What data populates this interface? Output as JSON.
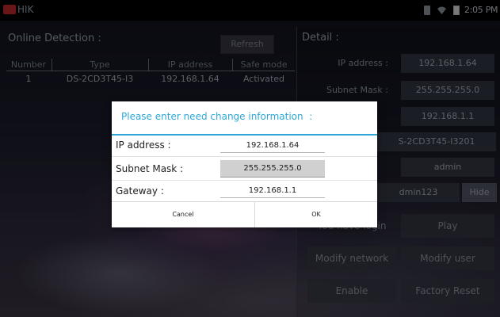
{
  "statusbar": {
    "app_title": "HIK",
    "time": "2:05 PM",
    "icons": [
      "app-logo-icon",
      "sim-card-icon",
      "wifi-icon",
      "battery-icon"
    ]
  },
  "online_detection": {
    "title": "Online Detection :",
    "refresh_label": "Refresh",
    "columns": [
      "Number",
      "Type",
      "IP address",
      "Safe mode"
    ],
    "rows": [
      {
        "number": "1",
        "type": "DS-2CD3T45-I3",
        "ip": "192.168.1.64",
        "safe_mode": "Activated"
      }
    ]
  },
  "detail": {
    "title": "Detail :",
    "ip_label": "IP address :",
    "ip_value": "192.168.1.64",
    "mask_label": "Subnet Mask :",
    "mask_value": "255.255.255.0",
    "gateway_value": "192.168.1.1",
    "model_value": "S-2CD3T45-I3201",
    "user_value": "admin",
    "password_value": "dmin123",
    "hide_label": "Hide",
    "login_status": "You have login",
    "play_label": "Play",
    "modify_network_label": "Modify network",
    "modify_user_label": "Modify user",
    "enable_label": "Enable",
    "factory_reset_label": "Factory Reset"
  },
  "dialog": {
    "title": "Please enter need change information  :",
    "ip_label": "IP address :",
    "ip_value": "192.168.1.64",
    "mask_label": "Subnet Mask :",
    "mask_value": "255.255.255.0",
    "gateway_label": "Gateway :",
    "gateway_value": "192.168.1.1",
    "cancel_label": "Cancel",
    "ok_label": "OK"
  },
  "colors": {
    "accent": "#2ea7d6",
    "statusbar_bg": "#000000",
    "dialog_bg": "#ffffff"
  }
}
